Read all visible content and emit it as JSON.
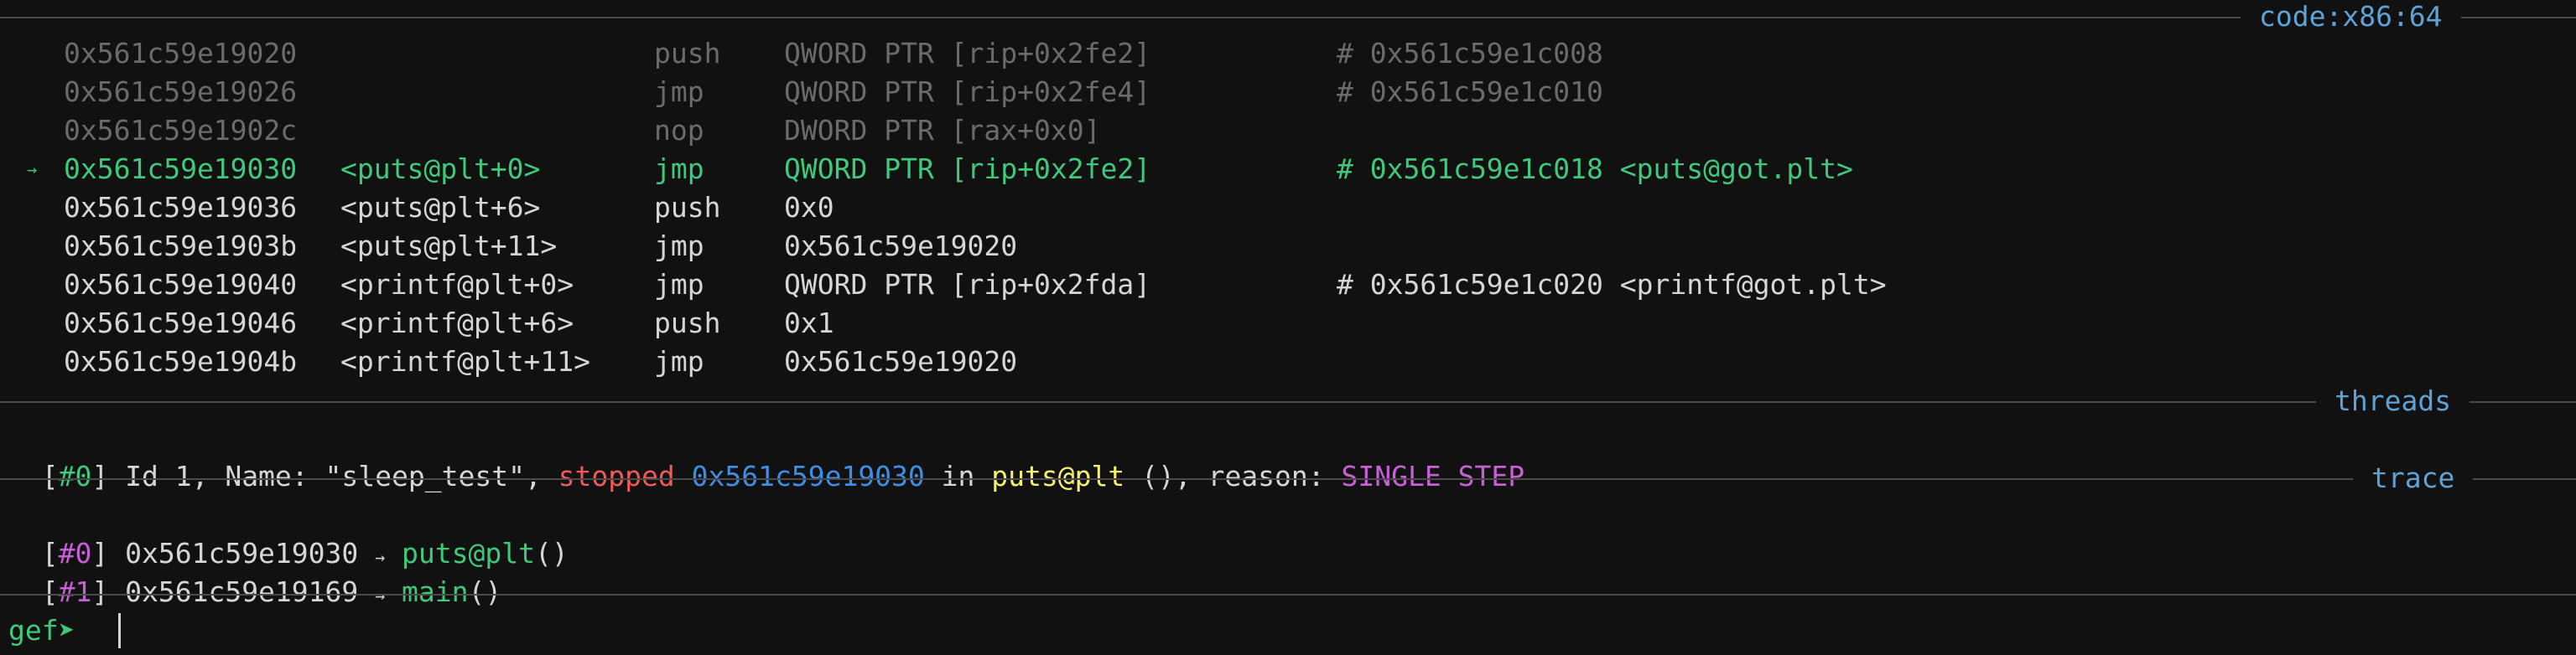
{
  "sections": {
    "code_label": "code:x86:64",
    "threads_label": "threads",
    "trace_label": "trace"
  },
  "code": {
    "current_arrow": "→",
    "rows": [
      {
        "addr": "0x561c59e19020",
        "sym": "",
        "op": "push",
        "args": "QWORD PTR [rip+0x2fe2]",
        "comment": "# 0x561c59e1c008",
        "style": "dim"
      },
      {
        "addr": "0x561c59e19026",
        "sym": "",
        "op": "jmp",
        "args": "QWORD PTR [rip+0x2fe4]",
        "comment": "# 0x561c59e1c010",
        "style": "dim"
      },
      {
        "addr": "0x561c59e1902c",
        "sym": "",
        "op": "nop",
        "args": "DWORD PTR [rax+0x0]",
        "comment": "",
        "style": "dim"
      },
      {
        "addr": "0x561c59e19030",
        "sym": "<puts@plt+0>",
        "op": "jmp",
        "args": "QWORD PTR [rip+0x2fe2]",
        "comment": "# 0x561c59e1c018 <puts@got.plt>",
        "style": "current"
      },
      {
        "addr": "0x561c59e19036",
        "sym": "<puts@plt+6>",
        "op": "push",
        "args": "0x0",
        "comment": "",
        "style": "normal"
      },
      {
        "addr": "0x561c59e1903b",
        "sym": "<puts@plt+11>",
        "op": "jmp",
        "args": "0x561c59e19020",
        "comment": "",
        "style": "normal"
      },
      {
        "addr": "0x561c59e19040",
        "sym": "<printf@plt+0>",
        "op": "jmp",
        "args": "QWORD PTR [rip+0x2fda]",
        "comment": "# 0x561c59e1c020 <printf@got.plt>",
        "style": "normal"
      },
      {
        "addr": "0x561c59e19046",
        "sym": "<printf@plt+6>",
        "op": "push",
        "args": "0x1",
        "comment": "",
        "style": "normal"
      },
      {
        "addr": "0x561c59e1904b",
        "sym": "<printf@plt+11>",
        "op": "jmp",
        "args": "0x561c59e19020",
        "comment": "",
        "style": "normal"
      }
    ]
  },
  "thread": {
    "lb": "[",
    "index": "#0",
    "rb": "]",
    "id_name": " Id 1, Name: \"sleep_test\", ",
    "state": "stopped",
    "addr": "0x561c59e19030",
    "in_text": " in ",
    "func": "puts@plt",
    "reason_text": " (), reason: ",
    "reason": "SINGLE STEP"
  },
  "trace": [
    {
      "lb": "[",
      "index": "#0",
      "rb": "]",
      "addr": " 0x561c59e19030 ",
      "arrow": "→",
      "func": " puts@plt",
      "parens": "()"
    },
    {
      "lb": "[",
      "index": "#1",
      "rb": "]",
      "addr": " 0x561c59e19169 ",
      "arrow": "→",
      "func": " main",
      "parens": "()"
    }
  ],
  "prompt": {
    "text": "gef➤"
  },
  "colors": {
    "background": "#111111",
    "separator": "#4a4a4a",
    "section_label": "#5fa3d6",
    "current_line": "#3fc97a",
    "dim": "#6b6b6b",
    "stopped": "#f25a5a",
    "address": "#3e8ee6",
    "function": "#f7f06e",
    "reason": "#c85fd6"
  }
}
